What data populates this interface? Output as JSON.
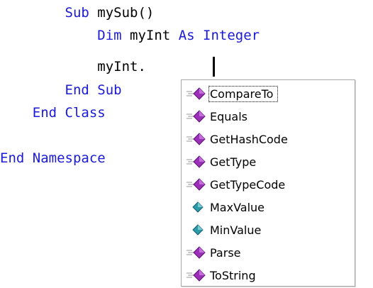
{
  "editor": {
    "lines": [
      {
        "indent": "        ",
        "parts": [
          {
            "text": "Sub",
            "kind": "keyword"
          },
          {
            "text": " mySub()",
            "kind": "identifier"
          }
        ]
      },
      {
        "indent": "            ",
        "parts": [
          {
            "text": "Dim",
            "kind": "keyword"
          },
          {
            "text": " myInt ",
            "kind": "identifier"
          },
          {
            "text": "As",
            "kind": "keyword"
          },
          {
            "text": " ",
            "kind": "identifier"
          },
          {
            "text": "Integer",
            "kind": "keyword"
          }
        ]
      },
      {
        "indent": "            ",
        "parts": [
          {
            "text": "myInt.",
            "kind": "identifier"
          }
        ]
      },
      {
        "indent": "        ",
        "parts": [
          {
            "text": "End Sub",
            "kind": "keyword"
          }
        ]
      },
      {
        "indent": "    ",
        "parts": [
          {
            "text": "End Class",
            "kind": "keyword"
          }
        ]
      },
      {
        "indent": "",
        "parts": []
      },
      {
        "indent": "",
        "parts": [
          {
            "text": "End Namespace",
            "kind": "keyword"
          }
        ]
      }
    ]
  },
  "intellisense": {
    "selected_index": 0,
    "items": [
      {
        "label": "CompareTo",
        "icon": "method-icon"
      },
      {
        "label": "Equals",
        "icon": "method-icon"
      },
      {
        "label": "GetHashCode",
        "icon": "method-icon"
      },
      {
        "label": "GetType",
        "icon": "method-icon"
      },
      {
        "label": "GetTypeCode",
        "icon": "method-icon"
      },
      {
        "label": "MaxValue",
        "icon": "field-icon"
      },
      {
        "label": "MinValue",
        "icon": "field-icon"
      },
      {
        "label": "Parse",
        "icon": "method-icon"
      },
      {
        "label": "ToString",
        "icon": "method-icon"
      }
    ]
  },
  "colors": {
    "keyword": "#1a1ad8",
    "identifier": "#000000",
    "method_icon": "#9b2fb8",
    "field_icon": "#2a9aa8"
  }
}
